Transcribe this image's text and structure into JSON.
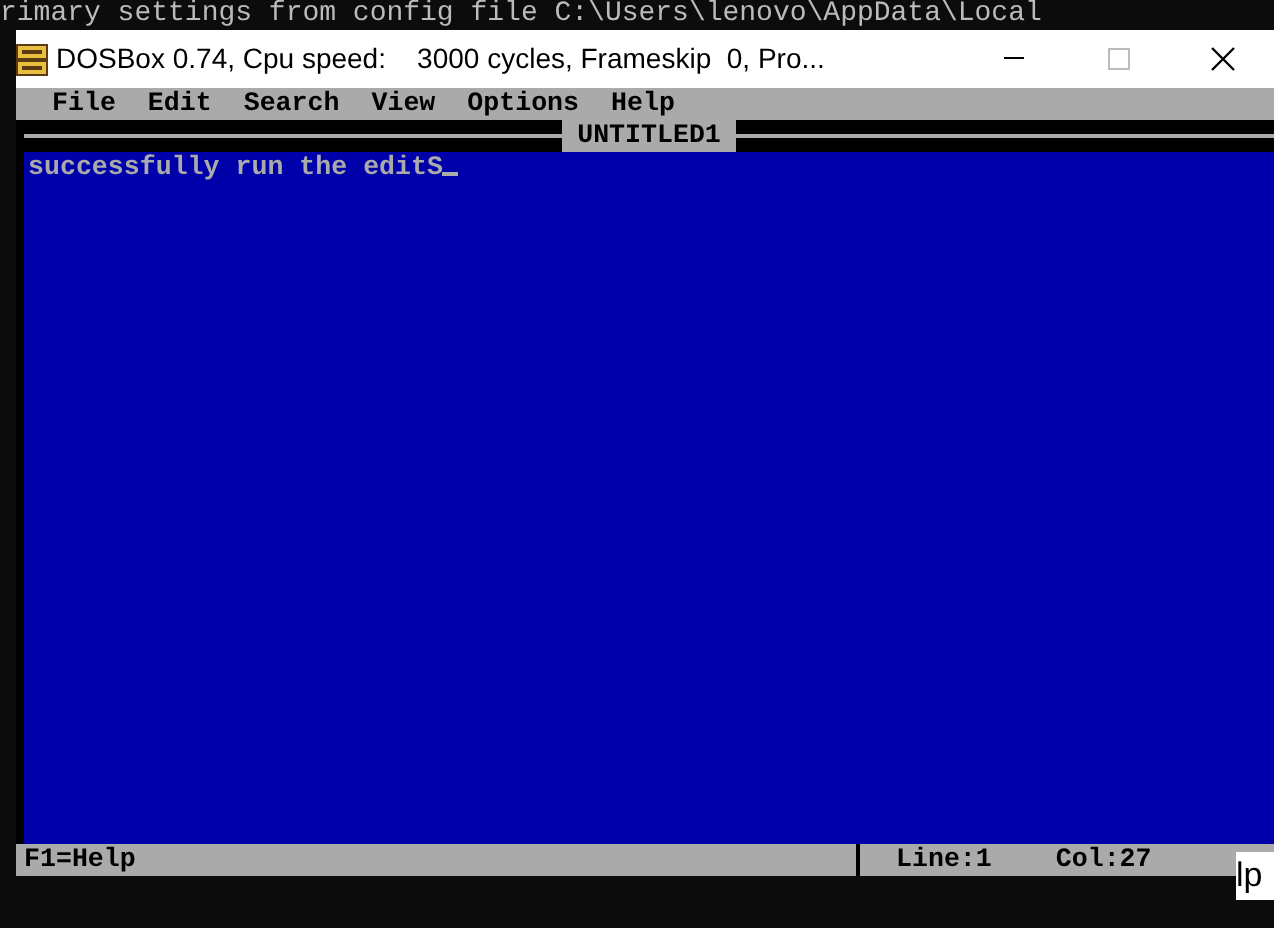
{
  "console_text": "rimary settings from config file C:\\Users\\lenovo\\AppData\\Local",
  "window": {
    "title": "DOSBox 0.74, Cpu speed:    3000 cycles, Frameskip  0, Pro..."
  },
  "menu": [
    "File",
    "Edit",
    "Search",
    "View",
    "Options",
    "Help"
  ],
  "document": {
    "title": "UNTITLED1",
    "lines": [
      "successfully run the editS"
    ],
    "cursor": true
  },
  "status_bar": {
    "help": "F1=Help",
    "line": "Line:1",
    "col": "Col:27"
  },
  "behind_window_text": "lp"
}
